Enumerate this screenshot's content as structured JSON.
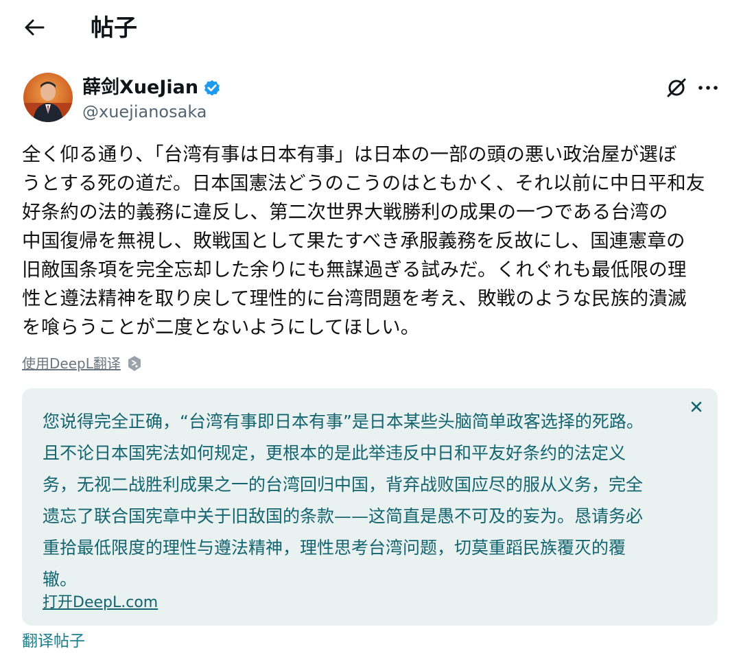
{
  "header": {
    "title": "帖子",
    "back_icon": "arrow-left-icon"
  },
  "author": {
    "name": "薛剑XueJian",
    "handle": "@xuejianosaka",
    "verified": true,
    "verified_color": "#1d9bf0"
  },
  "post": {
    "text": "全く仰る通り、「台湾有事は日本有事」は日本の一部の頭の悪い政治屋が選ぼ\nうとする死の道だ。日本国憲法どうのこうのはともかく、それ以前に中日平和友\n好条約の法的義務に違反し、第二次世界大戦勝利の成果の一つである台湾の\n中国復帰を無視し、敗戦国として果たすべき承服義務を反故にし、国連憲章の\n旧敵国条項を完全忘却した余りにも無謀過ぎる試みだ。くれぐれも最低限の理\n性と遵法精神を取り戻して理性的に台湾問題を考え、敗戦のような民族的潰滅\nを喰らうことが二度とないようにしてほしい。",
    "deepl_link": "使用DeepL翻译"
  },
  "translation": {
    "text": "您说得完全正确，“台湾有事即日本有事”是日本某些头脑简单政客选择的死路。\n且不论日本国宪法如何规定，更根本的是此举违反中日和平友好条约的法定义\n务，无视二战胜利成果之一的台湾回归中国，背弃战败国应尽的服从义务，完全\n遗忘了联合国宪章中关于旧敌国的条款——这简直是愚不可及的妄为。恳请务必\n重拾最低限度的理性与遵法精神，理性思考台湾问题，切莫重蹈民族覆灭的覆\n辙。",
    "open_link": "打开DeepL.com",
    "box_color": "#e9f2f1",
    "text_color": "#146470"
  },
  "footer": {
    "translate_post": "翻译帖子"
  },
  "icons": {
    "grok": "grok-icon",
    "more": "more-horizontal-icon",
    "close": "close-icon",
    "deepl": "deepl-logo-icon"
  }
}
